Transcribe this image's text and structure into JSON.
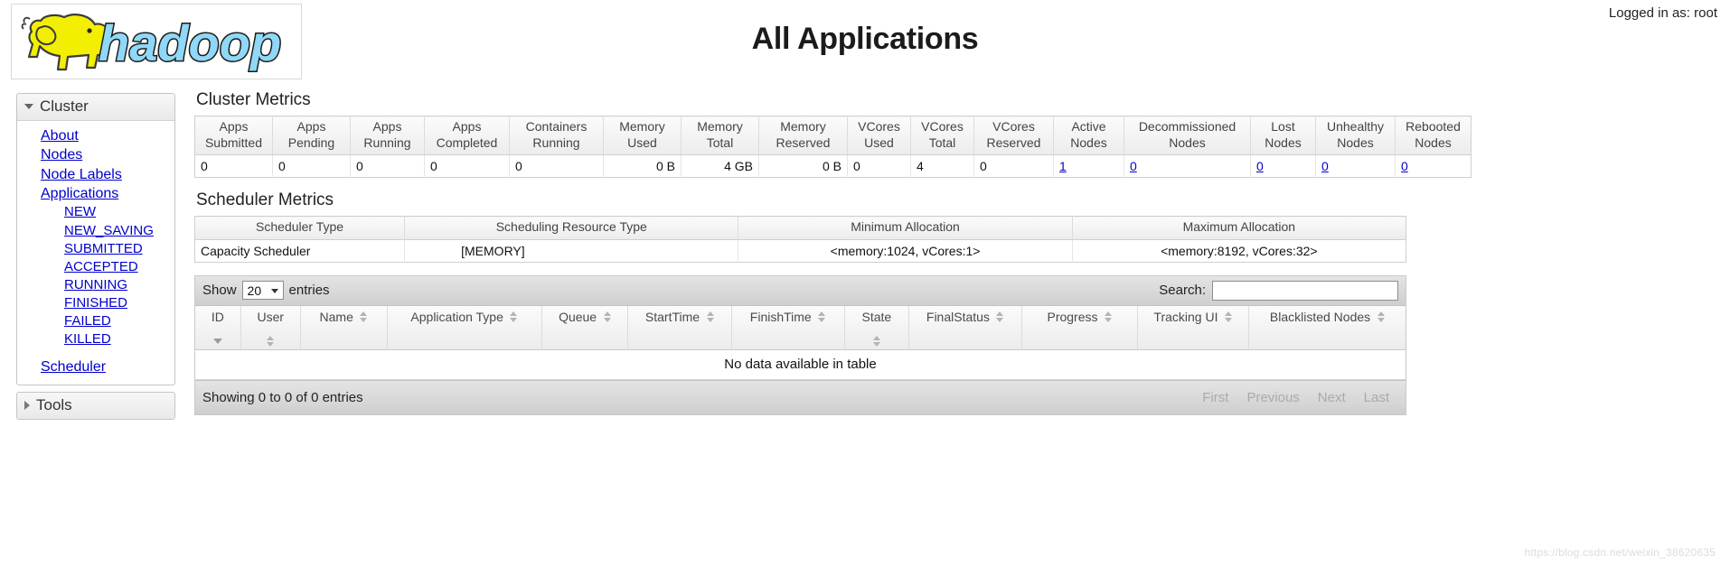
{
  "header": {
    "logged_in_label": "Logged in as: root",
    "page_title": "All Applications",
    "logo_alt": "hadoop-logo",
    "logo_text": "hadoop"
  },
  "sidebar": {
    "cluster": {
      "title": "Cluster",
      "links": [
        {
          "label": "About",
          "name": "sidebar-link-about"
        },
        {
          "label": "Nodes",
          "name": "sidebar-link-nodes"
        },
        {
          "label": "Node Labels",
          "name": "sidebar-link-node-labels"
        },
        {
          "label": "Applications",
          "name": "sidebar-link-applications"
        }
      ],
      "app_states": [
        {
          "label": "NEW"
        },
        {
          "label": "NEW_SAVING"
        },
        {
          "label": "SUBMITTED"
        },
        {
          "label": "ACCEPTED"
        },
        {
          "label": "RUNNING"
        },
        {
          "label": "FINISHED"
        },
        {
          "label": "FAILED"
        },
        {
          "label": "KILLED"
        }
      ],
      "scheduler_label": "Scheduler"
    },
    "tools": {
      "title": "Tools"
    }
  },
  "cluster_metrics": {
    "title": "Cluster Metrics",
    "columns": [
      {
        "line1": "Apps",
        "line2": "Submitted"
      },
      {
        "line1": "Apps",
        "line2": "Pending"
      },
      {
        "line1": "Apps",
        "line2": "Running"
      },
      {
        "line1": "Apps",
        "line2": "Completed"
      },
      {
        "line1": "Containers",
        "line2": "Running"
      },
      {
        "line1": "Memory",
        "line2": "Used"
      },
      {
        "line1": "Memory",
        "line2": "Total"
      },
      {
        "line1": "Memory",
        "line2": "Reserved"
      },
      {
        "line1": "VCores",
        "line2": "Used"
      },
      {
        "line1": "VCores",
        "line2": "Total"
      },
      {
        "line1": "VCores",
        "line2": "Reserved"
      },
      {
        "line1": "Active",
        "line2": "Nodes"
      },
      {
        "line1": "Decommissioned",
        "line2": "Nodes"
      },
      {
        "line1": "Lost",
        "line2": "Nodes"
      },
      {
        "line1": "Unhealthy",
        "line2": "Nodes"
      },
      {
        "line1": "Rebooted",
        "line2": "Nodes"
      }
    ],
    "row": [
      {
        "value": "0",
        "align": "left",
        "link": false
      },
      {
        "value": "0",
        "align": "left",
        "link": false
      },
      {
        "value": "0",
        "align": "left",
        "link": false
      },
      {
        "value": "0",
        "align": "left",
        "link": false
      },
      {
        "value": "0",
        "align": "left",
        "link": false
      },
      {
        "value": "0 B",
        "align": "right",
        "link": false
      },
      {
        "value": "4 GB",
        "align": "right",
        "link": false
      },
      {
        "value": "0 B",
        "align": "right",
        "link": false
      },
      {
        "value": "0",
        "align": "left",
        "link": false
      },
      {
        "value": "4",
        "align": "left",
        "link": false
      },
      {
        "value": "0",
        "align": "left",
        "link": false
      },
      {
        "value": "1",
        "align": "left",
        "link": true
      },
      {
        "value": "0",
        "align": "left",
        "link": true
      },
      {
        "value": "0",
        "align": "left",
        "link": true
      },
      {
        "value": "0",
        "align": "left",
        "link": true
      },
      {
        "value": "0",
        "align": "left",
        "link": true
      }
    ]
  },
  "scheduler_metrics": {
    "title": "Scheduler Metrics",
    "columns": [
      "Scheduler Type",
      "Scheduling Resource Type",
      "Minimum Allocation",
      "Maximum Allocation"
    ],
    "row": {
      "scheduler_type": "Capacity Scheduler",
      "scheduling_resource_type": "[MEMORY]",
      "minimum_allocation": "<memory:1024, vCores:1>",
      "maximum_allocation": "<memory:8192, vCores:32>"
    }
  },
  "apps_table": {
    "show_label": "Show",
    "entries_label": "entries",
    "page_length": "20",
    "search_label": "Search:",
    "search_value": "",
    "search_placeholder": "",
    "columns": [
      {
        "label": "ID",
        "sort": "desc",
        "stacked": true
      },
      {
        "label": "User",
        "sort": "both",
        "stacked": true
      },
      {
        "label": "Name",
        "sort": "both",
        "stacked": false
      },
      {
        "label": "Application Type",
        "sort": "both",
        "stacked": false
      },
      {
        "label": "Queue",
        "sort": "both",
        "stacked": false
      },
      {
        "label": "StartTime",
        "sort": "both",
        "stacked": false
      },
      {
        "label": "FinishTime",
        "sort": "both",
        "stacked": false
      },
      {
        "label": "State",
        "sort": "both",
        "stacked": true
      },
      {
        "label": "FinalStatus",
        "sort": "both",
        "stacked": false
      },
      {
        "label": "Progress",
        "sort": "both",
        "stacked": false
      },
      {
        "label": "Tracking UI",
        "sort": "both",
        "stacked": false
      },
      {
        "label": "Blacklisted Nodes",
        "sort": "both",
        "stacked": false
      }
    ],
    "rows": [],
    "empty_message": "No data available in table",
    "info_label": "Showing 0 to 0 of 0 entries",
    "pagination": [
      {
        "label": "First",
        "enabled": false
      },
      {
        "label": "Previous",
        "enabled": false
      },
      {
        "label": "Next",
        "enabled": false
      },
      {
        "label": "Last",
        "enabled": false
      }
    ]
  },
  "watermark": {
    "text": "https://blog.csdn.net/weixin_38620635"
  },
  "colors": {
    "link": "#0000cc",
    "logo_yellow": "#f2ef00",
    "logo_blue": "#8fd8f7",
    "toolbar_gray": "#d8d8d8"
  }
}
